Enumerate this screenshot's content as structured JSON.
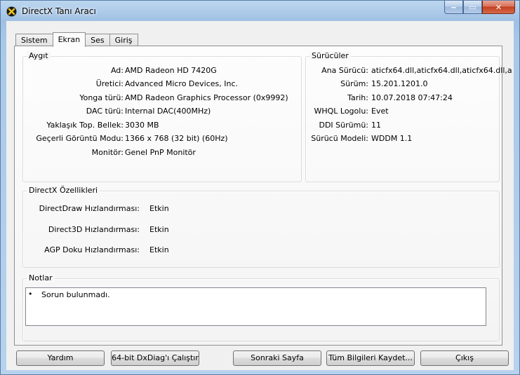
{
  "window": {
    "title": "DirectX Tanı Aracı",
    "caption": {
      "minimize": "‒",
      "maximize": "▭",
      "close": "✕"
    }
  },
  "tabs": [
    "Sistem",
    "Ekran",
    "Ses",
    "Giriş"
  ],
  "active_tab": "Ekran",
  "device": {
    "heading": "Aygıt",
    "rows": [
      {
        "label": "Ad:",
        "value": "AMD Radeon HD 7420G"
      },
      {
        "label": "Üretici:",
        "value": "Advanced Micro Devices, Inc."
      },
      {
        "label": "Yonga türü:",
        "value": "AMD Radeon Graphics Processor (0x9992)"
      },
      {
        "label": "DAC türü:",
        "value": "Internal DAC(400MHz)"
      },
      {
        "label": "Yaklaşık Top. Bellek:",
        "value": "3030 MB"
      },
      {
        "label": "Geçerli Görüntü Modu:",
        "value": "1366 x 768 (32 bit) (60Hz)"
      },
      {
        "label": "Monitör:",
        "value": "Genel PnP Monitör"
      }
    ]
  },
  "drivers": {
    "heading": "Sürücüler",
    "rows": [
      {
        "label": "Ana Sürücü:",
        "value": "aticfx64.dll,aticfx64.dll,aticfx64.dll,a"
      },
      {
        "label": "Sürüm:",
        "value": "15.201.1201.0"
      },
      {
        "label": "Tarih:",
        "value": "10.07.2018 07:47:24"
      },
      {
        "label": "WHQL Logolu:",
        "value": "Evet"
      },
      {
        "label": "DDI Sürümü:",
        "value": "11"
      },
      {
        "label": "Sürücü Modeli:",
        "value": "WDDM 1.1"
      }
    ]
  },
  "features": {
    "heading": "DirectX Özellikleri",
    "rows": [
      {
        "label": "DirectDraw Hızlandırması:",
        "value": "Etkin"
      },
      {
        "label": "Direct3D Hızlandırması:",
        "value": "Etkin"
      },
      {
        "label": "AGP Doku Hızlandırması:",
        "value": "Etkin"
      }
    ]
  },
  "notes": {
    "heading": "Notlar",
    "bullet": "•",
    "items": [
      "Sorun bulunmadı."
    ]
  },
  "buttons": {
    "help": "Yardım",
    "run64": "64-bit DxDiag'ı Çalıştır",
    "next": "Sonraki Sayfa",
    "save": "Tüm Bilgileri Kaydet...",
    "exit": "Çıkış"
  }
}
